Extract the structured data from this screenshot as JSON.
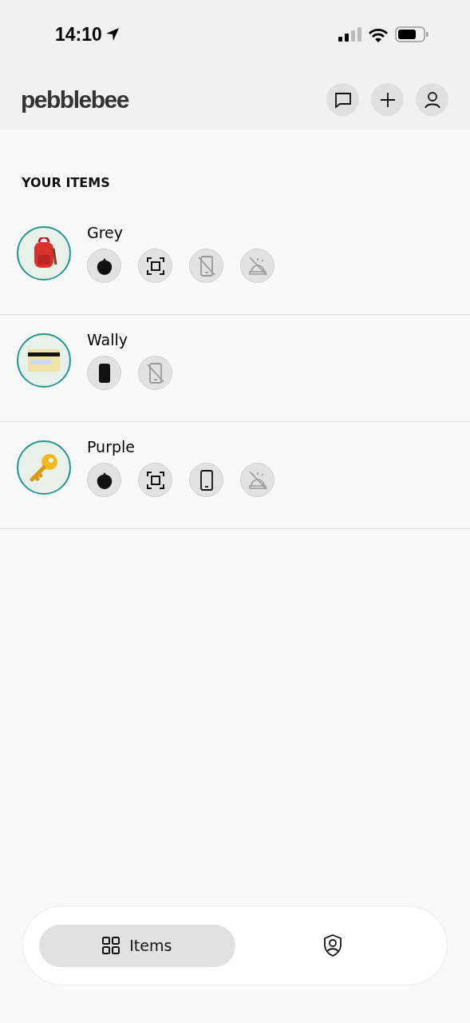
{
  "status_bar": {
    "time": "14:10"
  },
  "header": {
    "logo": "pebblebee"
  },
  "section_title": "YOUR ITEMS",
  "items": [
    {
      "name": "Grey",
      "kind": "backpack",
      "features": [
        {
          "kind": "tag",
          "disabled": false
        },
        {
          "kind": "scan",
          "disabled": false
        },
        {
          "kind": "phone",
          "disabled": true
        },
        {
          "kind": "alarm",
          "disabled": true
        }
      ]
    },
    {
      "name": "Wally",
      "kind": "card",
      "features": [
        {
          "kind": "card",
          "disabled": false
        },
        {
          "kind": "phone",
          "disabled": true
        }
      ]
    },
    {
      "name": "Purple",
      "kind": "key",
      "features": [
        {
          "kind": "tag",
          "disabled": false
        },
        {
          "kind": "scan",
          "disabled": false
        },
        {
          "kind": "phone",
          "disabled": false
        },
        {
          "kind": "alarm",
          "disabled": true
        }
      ]
    }
  ],
  "tabs": [
    {
      "kind": "items",
      "label": "Items",
      "selected": true
    },
    {
      "kind": "safety",
      "selected": false
    }
  ]
}
